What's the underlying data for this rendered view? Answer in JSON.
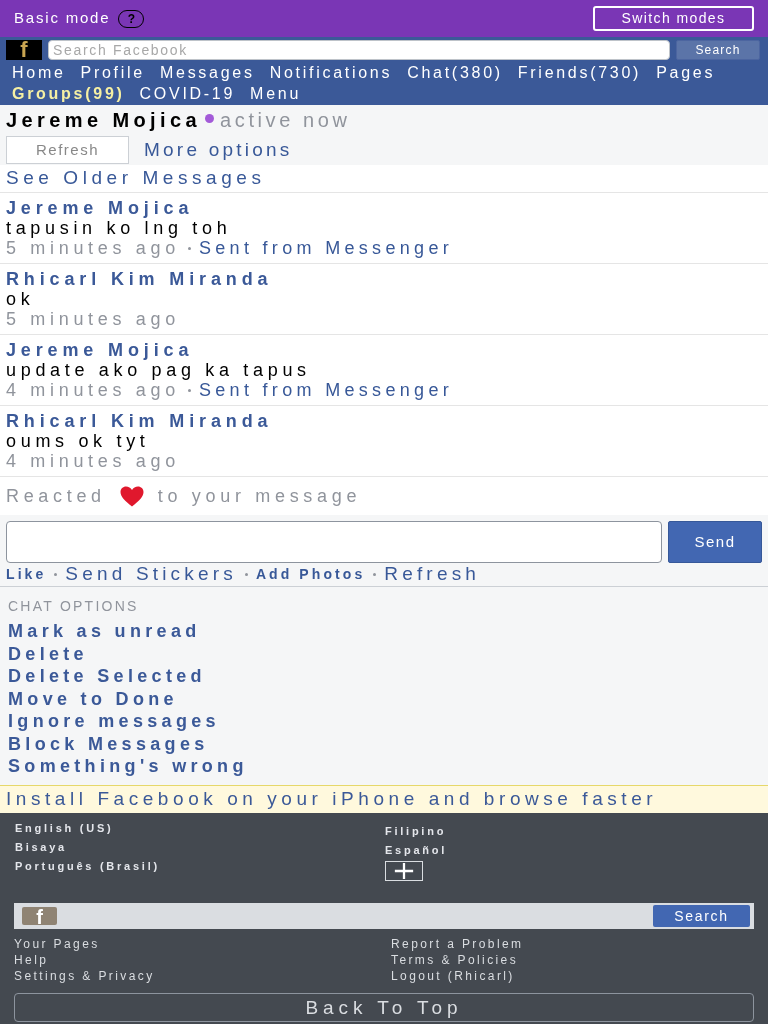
{
  "top_bar": {
    "label": "Basic mode",
    "help": "?",
    "switch_button": "Switch modes"
  },
  "header": {
    "logo": "f",
    "search": {
      "placeholder": "Search Facebook"
    },
    "search_button": "Search",
    "nav": [
      {
        "label": "Home",
        "highlighted": false
      },
      {
        "label": "Profile",
        "highlighted": false
      },
      {
        "label": "Messages",
        "highlighted": false
      },
      {
        "label": "Notifications",
        "highlighted": false
      },
      {
        "label": "Chat(380)",
        "highlighted": false
      },
      {
        "label": "Friends(730)",
        "highlighted": false
      },
      {
        "label": "Pages",
        "highlighted": false
      },
      {
        "label": "Groups(99)",
        "highlighted": true
      },
      {
        "label": "COVID-19",
        "highlighted": false
      },
      {
        "label": "Menu",
        "highlighted": false
      }
    ]
  },
  "conversation": {
    "name": "Jereme Mojica",
    "online": true,
    "status": "active now",
    "refresh_button": "Refresh",
    "more_options": "More options"
  },
  "older_link": "See Older Messages",
  "messages": [
    {
      "sender": "Jereme Mojica",
      "text": "tapusin ko lng toh",
      "time": "5 minutes ago",
      "source": "Sent from Messenger"
    },
    {
      "sender": "Rhicarl Kim Miranda",
      "text": "ok",
      "time": "5 minutes ago"
    },
    {
      "sender": "Jereme Mojica",
      "text": "update ako pag ka tapus",
      "time": "4 minutes ago",
      "source": "Sent from Messenger"
    },
    {
      "sender": "Rhicarl Kim Miranda",
      "text": "oums ok tyt",
      "time": "4 minutes ago"
    }
  ],
  "reaction": {
    "before": "Reacted",
    "after": "to your message"
  },
  "composer": {
    "send_button": "Send",
    "actions": [
      {
        "label": "Like",
        "kind": "bold"
      },
      {
        "label": "Send Stickers",
        "kind": "regular"
      },
      {
        "label": "Add Photos",
        "kind": "bold"
      },
      {
        "label": "Refresh",
        "kind": "regular"
      }
    ]
  },
  "chat_options": {
    "title": "CHAT OPTIONS",
    "items": [
      "Mark as unread",
      "Delete",
      "Delete Selected",
      "Move to Done",
      "Ignore messages",
      "Block Messages",
      "Something's wrong"
    ]
  },
  "install_banner": "Install Facebook on your iPhone and browse faster",
  "footer": {
    "languages_left": [
      "English (US)",
      "Bisaya",
      "Português (Brasil)"
    ],
    "languages_right": [
      "Filipino",
      "Español"
    ],
    "logo": "f",
    "search_button": "Search",
    "links_left": [
      "Your Pages",
      "Help",
      "Settings & Privacy"
    ],
    "links_right": [
      "Report a Problem",
      "Terms & Policies",
      "Logout (Rhicarl)"
    ],
    "back_to_top": "Back To Top"
  }
}
